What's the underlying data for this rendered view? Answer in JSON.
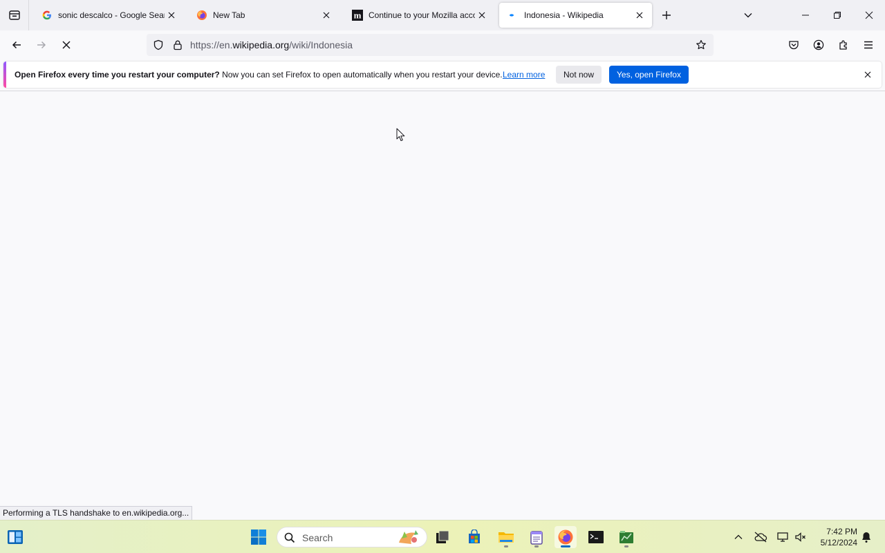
{
  "browser": {
    "tabs": [
      {
        "title": "sonic descalco - Google Search",
        "favicon": "google-icon",
        "active": false
      },
      {
        "title": "New Tab",
        "favicon": "firefox-icon",
        "active": false
      },
      {
        "title": "Continue to your Mozilla accou",
        "favicon": "mozilla-icon",
        "active": false
      },
      {
        "title": "Indonesia - Wikipedia",
        "favicon": "loading-dot-icon",
        "active": true
      }
    ],
    "url": {
      "prefix": "https://en.",
      "domain": "wikipedia.org",
      "path": "/wiki/Indonesia"
    }
  },
  "notification": {
    "bold": "Open Firefox every time you restart your computer?",
    "message": " Now you can set Firefox to open automatically when you restart your device.",
    "link": "Learn more",
    "secondary_button": "Not now",
    "primary_button": "Yes, open Firefox"
  },
  "status": "Performing a TLS handshake to en.wikipedia.org...",
  "taskbar": {
    "search_placeholder": "Search",
    "time": "7:42 PM",
    "date": "5/12/2024"
  },
  "colors": {
    "accent": "#0061e0",
    "tab_bg": "#f0f0f4",
    "content_bg": "#f9f9fb"
  }
}
